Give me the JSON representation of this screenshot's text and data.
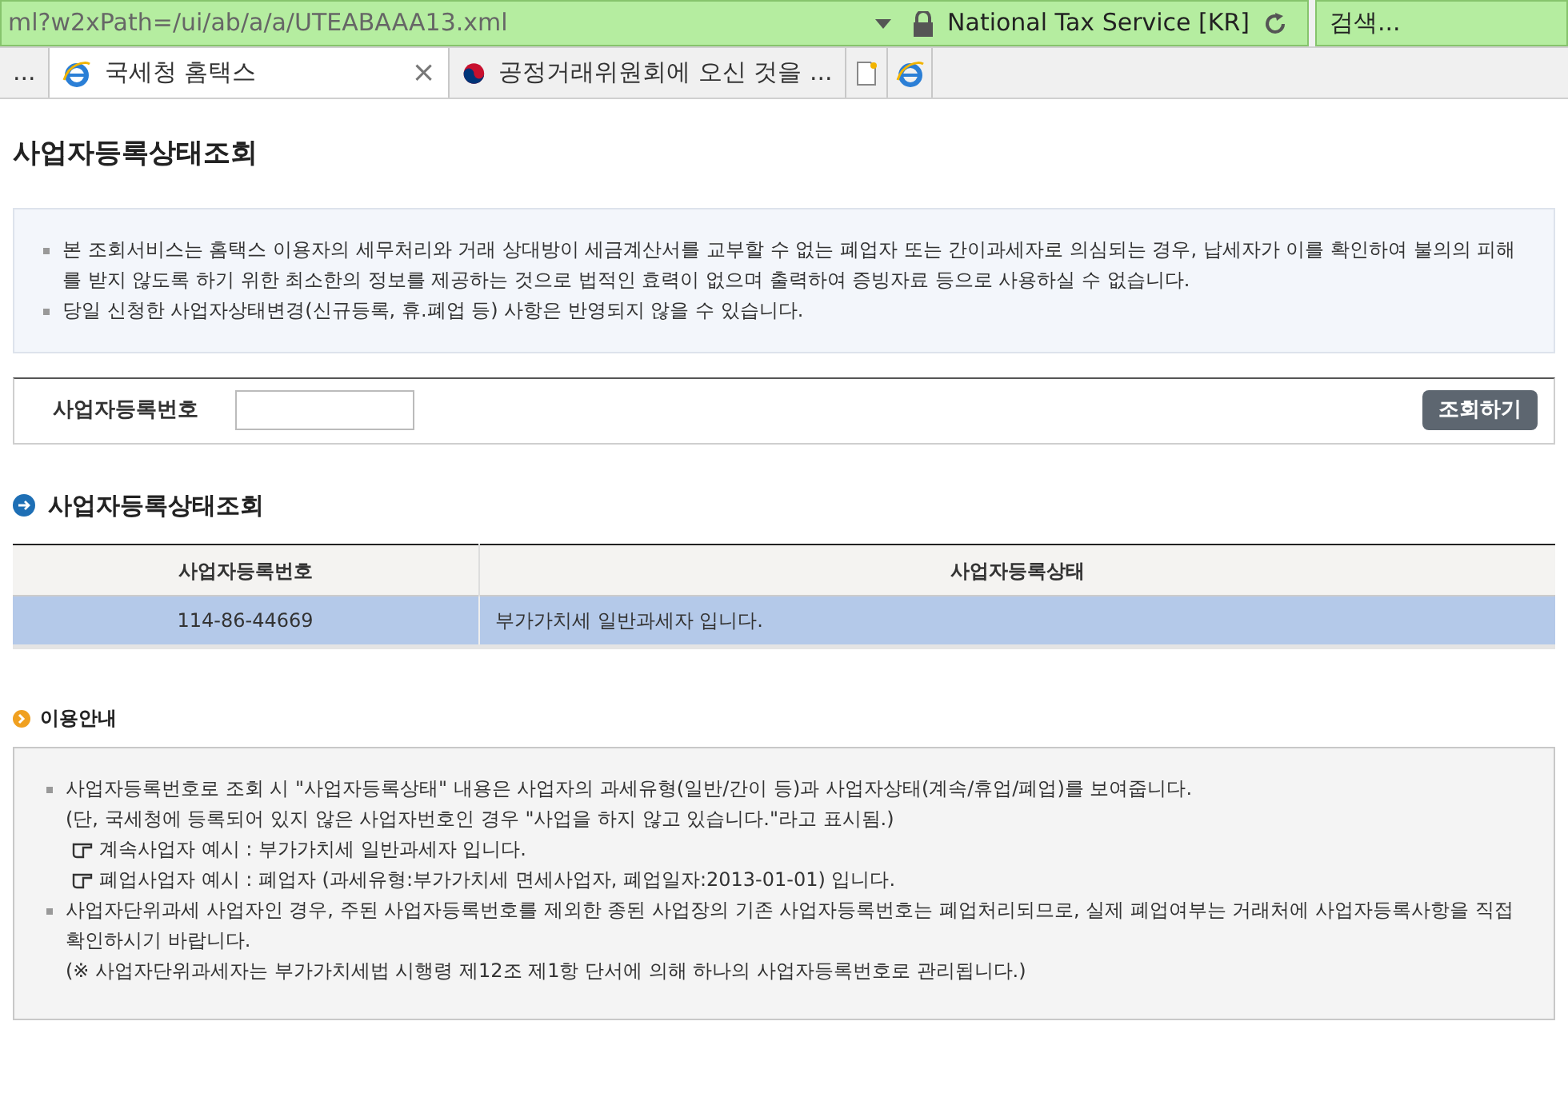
{
  "address_bar": {
    "url": "ml?w2xPath=/ui/ab/a/a/UTEABAAA13.xml",
    "site_identity": "National Tax Service [KR]"
  },
  "search": {
    "placeholder": "검색..."
  },
  "tabs": [
    {
      "label": "...",
      "selected": false,
      "kind": "plain"
    },
    {
      "label": "국세청 홈택스",
      "selected": true,
      "kind": "browser",
      "close": "×"
    },
    {
      "label": "공정거래위원회에 오신 것을 ...",
      "selected": false,
      "kind": "agency"
    }
  ],
  "page_title": "사업자등록상태조회",
  "notice": [
    "본 조회서비스는 홈택스 이용자의 세무처리와 거래 상대방이 세금계산서를 교부할 수 없는 폐업자 또는 간이과세자로 의심되는 경우, 납세자가 이를 확인하여 불의의 피해를 받지 않도록 하기 위한 최소한의 정보를 제공하는 것으로 법적인 효력이 없으며 출력하여 증빙자료 등으로 사용하실 수 없습니다.",
    "당일 신청한 사업자상태변경(신규등록, 휴.폐업 등) 사항은 반영되지 않을 수 있습니다."
  ],
  "query": {
    "label": "사업자등록번호",
    "button": "조회하기"
  },
  "result": {
    "heading": "사업자등록상태조회",
    "columns": [
      "사업자등록번호",
      "사업자등록상태"
    ],
    "rows": [
      {
        "cells": [
          "114-86-44669",
          "부가가치세 일반과세자 입니다."
        ],
        "selected": true
      }
    ]
  },
  "guide": {
    "heading": "이용안내",
    "lines": [
      {
        "kind": "bullet",
        "text": "사업자등록번호로 조회 시 \"사업자등록상태\" 내용은 사업자의 과세유형(일반/간이 등)과 사업자상태(계속/휴업/폐업)를 보여줍니다."
      },
      {
        "kind": "plain",
        "text": "(단, 국세청에 등록되어 있지 않은 사업자번호인 경우 \"사업을 하지 않고 있습니다.\"라고 표시됨.)"
      },
      {
        "kind": "example",
        "text": "계속사업자 예시 : 부가가치세 일반과세자 입니다."
      },
      {
        "kind": "example",
        "text": "폐업사업자 예시 : 폐업자 (과세유형:부가가치세 면세사업자, 폐업일자:2013-01-01) 입니다."
      },
      {
        "kind": "bullet",
        "text": "사업자단위과세 사업자인 경우, 주된 사업자등록번호를 제외한 종된 사업장의 기존 사업자등록번호는 폐업처리되므로, 실제 폐업여부는 거래처에 사업자등록사항을 직접 확인하시기 바랍니다."
      },
      {
        "kind": "plain",
        "text": "(※ 사업자단위과세자는 부가가치세법 시행령 제12조 제1항 단서에 의해 하나의 사업자등록번호로 관리됩니다.)"
      }
    ]
  }
}
